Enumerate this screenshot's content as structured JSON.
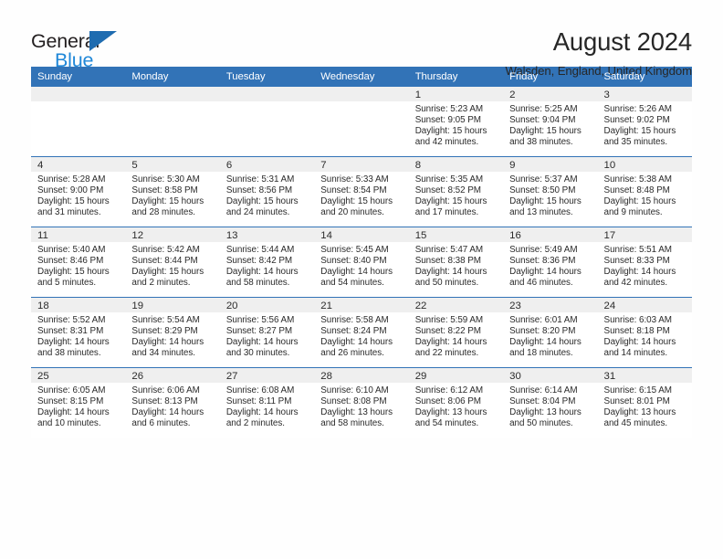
{
  "brand": {
    "line1": "General",
    "line2": "Blue",
    "accent_blue": "#1f6cb0",
    "light_blue": "#1f87d8"
  },
  "header": {
    "title": "August 2024",
    "subtitle": "Walsden, England, United Kingdom"
  },
  "calendar": {
    "header_bg": "#3273b7",
    "daynum_bg": "#efefef",
    "weekday_labels": [
      "Sunday",
      "Monday",
      "Tuesday",
      "Wednesday",
      "Thursday",
      "Friday",
      "Saturday"
    ],
    "labels": {
      "sunrise": "Sunrise:",
      "sunset": "Sunset:",
      "daylight": "Daylight:"
    },
    "weeks": [
      [
        {
          "day": "",
          "empty": true
        },
        {
          "day": "",
          "empty": true
        },
        {
          "day": "",
          "empty": true
        },
        {
          "day": "",
          "empty": true
        },
        {
          "day": "1",
          "sunrise": "Sunrise: 5:23 AM",
          "sunset": "Sunset: 9:05 PM",
          "daylight_line1": "Daylight: 15 hours",
          "daylight_line2": "and 42 minutes."
        },
        {
          "day": "2",
          "sunrise": "Sunrise: 5:25 AM",
          "sunset": "Sunset: 9:04 PM",
          "daylight_line1": "Daylight: 15 hours",
          "daylight_line2": "and 38 minutes."
        },
        {
          "day": "3",
          "sunrise": "Sunrise: 5:26 AM",
          "sunset": "Sunset: 9:02 PM",
          "daylight_line1": "Daylight: 15 hours",
          "daylight_line2": "and 35 minutes."
        }
      ],
      [
        {
          "day": "4",
          "sunrise": "Sunrise: 5:28 AM",
          "sunset": "Sunset: 9:00 PM",
          "daylight_line1": "Daylight: 15 hours",
          "daylight_line2": "and 31 minutes."
        },
        {
          "day": "5",
          "sunrise": "Sunrise: 5:30 AM",
          "sunset": "Sunset: 8:58 PM",
          "daylight_line1": "Daylight: 15 hours",
          "daylight_line2": "and 28 minutes."
        },
        {
          "day": "6",
          "sunrise": "Sunrise: 5:31 AM",
          "sunset": "Sunset: 8:56 PM",
          "daylight_line1": "Daylight: 15 hours",
          "daylight_line2": "and 24 minutes."
        },
        {
          "day": "7",
          "sunrise": "Sunrise: 5:33 AM",
          "sunset": "Sunset: 8:54 PM",
          "daylight_line1": "Daylight: 15 hours",
          "daylight_line2": "and 20 minutes."
        },
        {
          "day": "8",
          "sunrise": "Sunrise: 5:35 AM",
          "sunset": "Sunset: 8:52 PM",
          "daylight_line1": "Daylight: 15 hours",
          "daylight_line2": "and 17 minutes."
        },
        {
          "day": "9",
          "sunrise": "Sunrise: 5:37 AM",
          "sunset": "Sunset: 8:50 PM",
          "daylight_line1": "Daylight: 15 hours",
          "daylight_line2": "and 13 minutes."
        },
        {
          "day": "10",
          "sunrise": "Sunrise: 5:38 AM",
          "sunset": "Sunset: 8:48 PM",
          "daylight_line1": "Daylight: 15 hours",
          "daylight_line2": "and 9 minutes."
        }
      ],
      [
        {
          "day": "11",
          "sunrise": "Sunrise: 5:40 AM",
          "sunset": "Sunset: 8:46 PM",
          "daylight_line1": "Daylight: 15 hours",
          "daylight_line2": "and 5 minutes."
        },
        {
          "day": "12",
          "sunrise": "Sunrise: 5:42 AM",
          "sunset": "Sunset: 8:44 PM",
          "daylight_line1": "Daylight: 15 hours",
          "daylight_line2": "and 2 minutes."
        },
        {
          "day": "13",
          "sunrise": "Sunrise: 5:44 AM",
          "sunset": "Sunset: 8:42 PM",
          "daylight_line1": "Daylight: 14 hours",
          "daylight_line2": "and 58 minutes."
        },
        {
          "day": "14",
          "sunrise": "Sunrise: 5:45 AM",
          "sunset": "Sunset: 8:40 PM",
          "daylight_line1": "Daylight: 14 hours",
          "daylight_line2": "and 54 minutes."
        },
        {
          "day": "15",
          "sunrise": "Sunrise: 5:47 AM",
          "sunset": "Sunset: 8:38 PM",
          "daylight_line1": "Daylight: 14 hours",
          "daylight_line2": "and 50 minutes."
        },
        {
          "day": "16",
          "sunrise": "Sunrise: 5:49 AM",
          "sunset": "Sunset: 8:36 PM",
          "daylight_line1": "Daylight: 14 hours",
          "daylight_line2": "and 46 minutes."
        },
        {
          "day": "17",
          "sunrise": "Sunrise: 5:51 AM",
          "sunset": "Sunset: 8:33 PM",
          "daylight_line1": "Daylight: 14 hours",
          "daylight_line2": "and 42 minutes."
        }
      ],
      [
        {
          "day": "18",
          "sunrise": "Sunrise: 5:52 AM",
          "sunset": "Sunset: 8:31 PM",
          "daylight_line1": "Daylight: 14 hours",
          "daylight_line2": "and 38 minutes."
        },
        {
          "day": "19",
          "sunrise": "Sunrise: 5:54 AM",
          "sunset": "Sunset: 8:29 PM",
          "daylight_line1": "Daylight: 14 hours",
          "daylight_line2": "and 34 minutes."
        },
        {
          "day": "20",
          "sunrise": "Sunrise: 5:56 AM",
          "sunset": "Sunset: 8:27 PM",
          "daylight_line1": "Daylight: 14 hours",
          "daylight_line2": "and 30 minutes."
        },
        {
          "day": "21",
          "sunrise": "Sunrise: 5:58 AM",
          "sunset": "Sunset: 8:24 PM",
          "daylight_line1": "Daylight: 14 hours",
          "daylight_line2": "and 26 minutes."
        },
        {
          "day": "22",
          "sunrise": "Sunrise: 5:59 AM",
          "sunset": "Sunset: 8:22 PM",
          "daylight_line1": "Daylight: 14 hours",
          "daylight_line2": "and 22 minutes."
        },
        {
          "day": "23",
          "sunrise": "Sunrise: 6:01 AM",
          "sunset": "Sunset: 8:20 PM",
          "daylight_line1": "Daylight: 14 hours",
          "daylight_line2": "and 18 minutes."
        },
        {
          "day": "24",
          "sunrise": "Sunrise: 6:03 AM",
          "sunset": "Sunset: 8:18 PM",
          "daylight_line1": "Daylight: 14 hours",
          "daylight_line2": "and 14 minutes."
        }
      ],
      [
        {
          "day": "25",
          "sunrise": "Sunrise: 6:05 AM",
          "sunset": "Sunset: 8:15 PM",
          "daylight_line1": "Daylight: 14 hours",
          "daylight_line2": "and 10 minutes."
        },
        {
          "day": "26",
          "sunrise": "Sunrise: 6:06 AM",
          "sunset": "Sunset: 8:13 PM",
          "daylight_line1": "Daylight: 14 hours",
          "daylight_line2": "and 6 minutes."
        },
        {
          "day": "27",
          "sunrise": "Sunrise: 6:08 AM",
          "sunset": "Sunset: 8:11 PM",
          "daylight_line1": "Daylight: 14 hours",
          "daylight_line2": "and 2 minutes."
        },
        {
          "day": "28",
          "sunrise": "Sunrise: 6:10 AM",
          "sunset": "Sunset: 8:08 PM",
          "daylight_line1": "Daylight: 13 hours",
          "daylight_line2": "and 58 minutes."
        },
        {
          "day": "29",
          "sunrise": "Sunrise: 6:12 AM",
          "sunset": "Sunset: 8:06 PM",
          "daylight_line1": "Daylight: 13 hours",
          "daylight_line2": "and 54 minutes."
        },
        {
          "day": "30",
          "sunrise": "Sunrise: 6:14 AM",
          "sunset": "Sunset: 8:04 PM",
          "daylight_line1": "Daylight: 13 hours",
          "daylight_line2": "and 50 minutes."
        },
        {
          "day": "31",
          "sunrise": "Sunrise: 6:15 AM",
          "sunset": "Sunset: 8:01 PM",
          "daylight_line1": "Daylight: 13 hours",
          "daylight_line2": "and 45 minutes."
        }
      ]
    ]
  }
}
